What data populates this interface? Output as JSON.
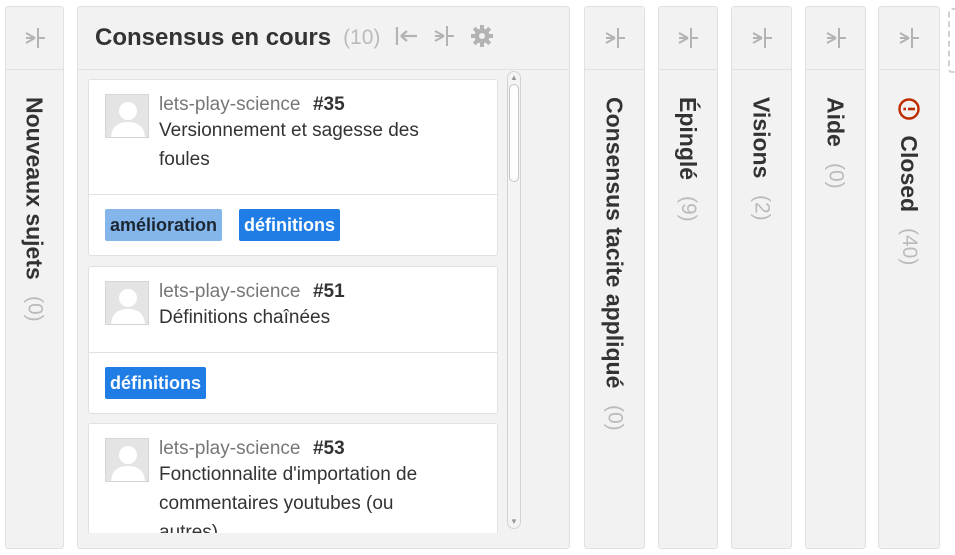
{
  "columns": [
    {
      "title": "Nouveaux sujets",
      "count": "(0)"
    },
    {
      "title": "Consensus tacite appliqué",
      "count": "(0)"
    },
    {
      "title": "Épinglé",
      "count": "(9)"
    },
    {
      "title": "Visions",
      "count": "(2)"
    },
    {
      "title": "Aide",
      "count": "(0)"
    },
    {
      "title": "Closed",
      "count": "(40)"
    }
  ],
  "open_column": {
    "title": "Consensus en cours",
    "count": "(10)",
    "cards": [
      {
        "repo": "lets-play-science",
        "number": "#35",
        "title_lines": [
          "Versionnement et sagesse des",
          "foules"
        ],
        "labels": [
          "amélioration",
          "définitions"
        ]
      },
      {
        "repo": "lets-play-science",
        "number": "#51",
        "title_lines": [
          "Définitions chaînées"
        ],
        "labels": [
          "définitions"
        ]
      },
      {
        "repo": "lets-play-science",
        "number": "#53",
        "title_lines": [
          "Fonctionnalite d'importation de",
          "commentaires youtubes (ou",
          "autres)"
        ]
      }
    ]
  },
  "colors": {
    "label_amelioration": "#84b6eb",
    "label_definitions": "#207de5",
    "closed_icon": "#bd2c00"
  },
  "icons": {
    "collapsed_header": "expand-icon",
    "collapse": "collapse-left-icon",
    "settings": "gear-icon",
    "closed": "closed-issue-icon"
  }
}
